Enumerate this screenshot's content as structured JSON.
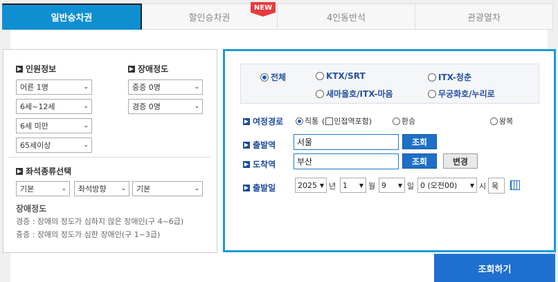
{
  "tabs": [
    {
      "label": "일반승차권",
      "active": true
    },
    {
      "label": "할인승차권",
      "badge": "NEW"
    },
    {
      "label": "4인동반석"
    },
    {
      "label": "관광열차"
    }
  ],
  "passengers": {
    "title": "인원정보",
    "adult": "어른 1명",
    "child": "6세~12세",
    "infant": "6세 미만",
    "senior": "65세이상"
  },
  "disability": {
    "title": "장애정도",
    "severe": "중증 0명",
    "mild": "경증 0명"
  },
  "seat_type": {
    "title": "좌석종류선택",
    "options": [
      "기본",
      "좌석방향",
      "기본"
    ]
  },
  "disability_info": {
    "title": "장애정도",
    "mild_desc": "경증 : 장애의 정도가 심하지 않은 장애인(구 4~6급)",
    "severe_desc": "중증 : 장애의 정도가 심한 장애인(구 1~3급)"
  },
  "train_types": [
    {
      "label": "전체",
      "checked": true
    },
    {
      "label": "KTX/SRT",
      "checked": false
    },
    {
      "label": "ITX-청춘",
      "checked": false
    },
    {
      "label": "새마을호/ITX-마음",
      "checked": false
    },
    {
      "label": "무궁화호/누리로",
      "checked": false
    }
  ],
  "route": {
    "label": "여정경로",
    "direct": "직통",
    "paren_open": "(",
    "adjacent": "인접역포함)",
    "transfer": "환승",
    "round_trip": "왕복"
  },
  "departure": {
    "label": "출발역",
    "value": "서울",
    "button": "조회"
  },
  "arrival": {
    "label": "도착역",
    "value": "부산",
    "button": "조회",
    "swap_button": "변경"
  },
  "date": {
    "label": "출발일",
    "year": "2025",
    "year_unit": "년",
    "month": "1",
    "month_unit": "월",
    "day": "9",
    "day_unit": "일",
    "hour": "0 (오전00)",
    "hour_unit": "시",
    "weekday": "목"
  },
  "search_button": "조회하기"
}
